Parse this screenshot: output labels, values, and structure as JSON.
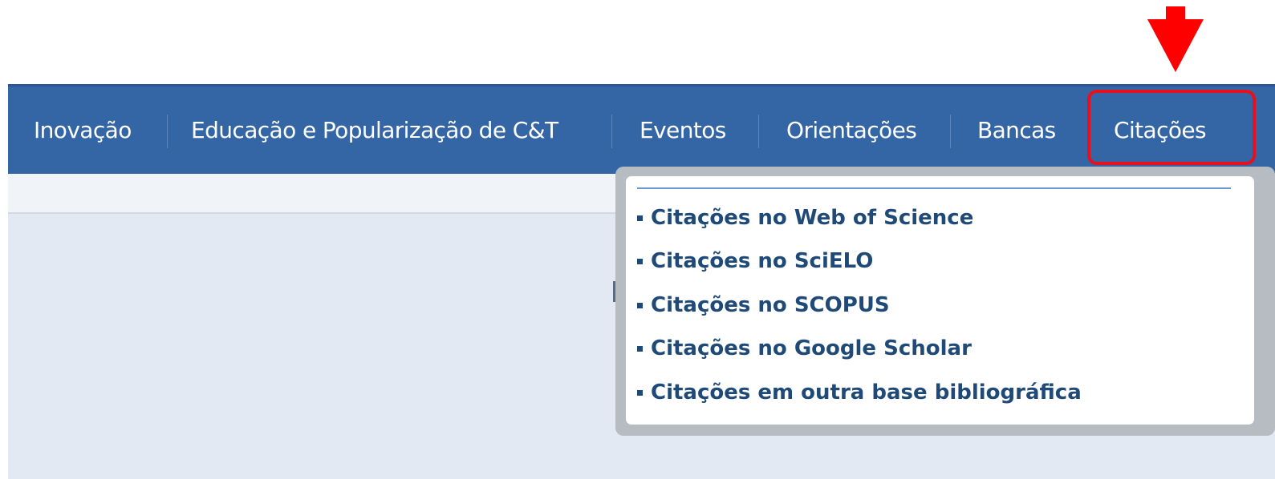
{
  "nav": {
    "items": [
      {
        "label": "Inovação"
      },
      {
        "label": "Educação e Popularização de C&T"
      },
      {
        "label": "Eventos"
      },
      {
        "label": "Orientações"
      },
      {
        "label": "Bancas"
      },
      {
        "label": "Citações"
      }
    ]
  },
  "dropdown": {
    "items": [
      {
        "label": "Citações no Web of Science"
      },
      {
        "label": "Citações no SciELO"
      },
      {
        "label": "Citações no SCOPUS"
      },
      {
        "label": "Citações no Google Scholar"
      },
      {
        "label": "Citações em outra base bibliográfica"
      }
    ]
  },
  "annotation": {
    "arrow_icon": "down-arrow-icon",
    "color": "#ff0000"
  },
  "colors": {
    "nav_background": "#3465a5",
    "menu_text": "#1f4a78",
    "highlight_border": "#e8101c"
  }
}
